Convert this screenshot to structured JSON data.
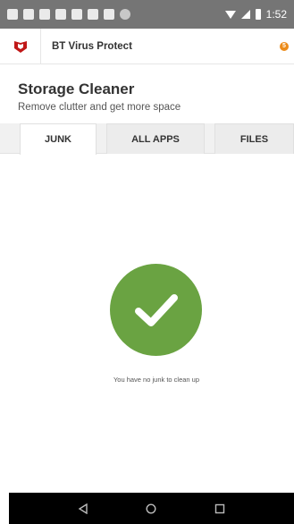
{
  "status_bar": {
    "time": "1:52",
    "icons": [
      "notification-icon",
      "email-icon",
      "image-icon",
      "shield-icon",
      "shield-icon",
      "photo-icon",
      "sim-icon",
      "dot-icon"
    ]
  },
  "app_bar": {
    "title": "BT Virus Protect",
    "badge": "5",
    "logo_color": "#c01818",
    "badge_color": "#ec8b1a"
  },
  "page": {
    "title": "Storage Cleaner",
    "subtitle": "Remove clutter and get more space"
  },
  "tabs": [
    {
      "label": "JUNK",
      "active": true
    },
    {
      "label": "ALL APPS",
      "active": false
    },
    {
      "label": "FILES",
      "active": false
    }
  ],
  "content": {
    "empty_message": "You have no junk to clean up",
    "check_color": "#6aa342"
  },
  "nav_bar": {
    "buttons": [
      "back-icon",
      "home-icon",
      "recents-icon"
    ]
  }
}
